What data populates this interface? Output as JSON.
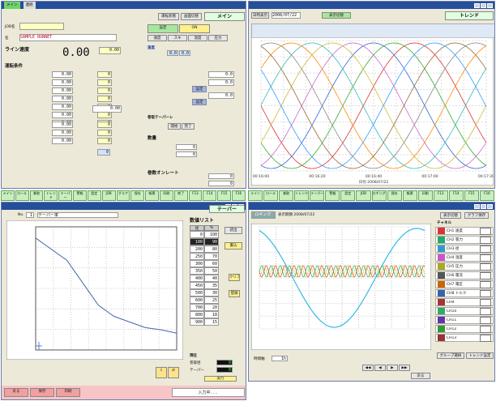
{
  "win_main": {
    "tabs": [
      "メイン",
      "連続"
    ],
    "header_buttons": [
      "運転状態",
      "画面切替"
    ],
    "header_title": "メイン",
    "job_label": "JOB名",
    "sample_label": "SAMPLE RUNNET",
    "main_section": "ライン速度",
    "big_value": "0.00",
    "top_value": "0.00",
    "run_label": "運転条件",
    "run_rows": [
      {
        "v1": "0.00",
        "v2": "0"
      },
      {
        "v1": "0.00",
        "v2": "0"
      },
      {
        "v1": "0.00",
        "v2": "0"
      },
      {
        "v1": "0.00",
        "v2": "0"
      },
      {
        "v1": "0.00",
        "v2": "0"
      },
      {
        "v1": "0.00",
        "v2": "0"
      },
      {
        "v1": "0.00",
        "v2": "0"
      }
    ],
    "mid_value": "0.00",
    "lower_rows": [
      {
        "v1": "0.00",
        "v2": "0"
      },
      {
        "v1": "0.00",
        "v2": "0"
      },
      {
        "v1": "0.00",
        "v2": "0"
      }
    ],
    "bottom_small": "0",
    "right_tabs": [
      "設定",
      "ON",
      "速度",
      "スキ",
      "温度",
      "圧力"
    ],
    "detail_label": "速度",
    "detail_val1": "0.0",
    "detail_val2": "0.0",
    "set_values": [
      "0.0",
      "0.0",
      "0.0"
    ],
    "buttons_blue": [
      "設定",
      "設定"
    ],
    "taper_label": "巻取テーパーレ",
    "taper_buttons": [
      "開始",
      "完了"
    ],
    "count_label": "数量",
    "count_vals": [
      "0",
      "0"
    ],
    "plate_label": "巻数オンレート",
    "plate_vals": [
      "0",
      "0"
    ]
  },
  "win_trend": {
    "header_btn": "日時表示",
    "date_field": "2008/07/22",
    "title": "トレンド",
    "green_btn": "表示切替",
    "x_labels": [
      "00:16:00",
      "00:16:20",
      "00:16:40",
      "00:17:00",
      "00:17:20"
    ],
    "x_caption": "日付:2008/07/22"
  },
  "fkeys_top": [
    "メイン",
    "ロール",
    "巻取",
    "トレンド",
    "テーパー",
    "警報",
    "設定",
    "JOB",
    "グラフ",
    "保存",
    "帳票",
    "印刷",
    "終了",
    "F13",
    "F14",
    "F15",
    "F16"
  ],
  "fkeys_right": [
    "メイン",
    "ロール",
    "巻取",
    "トレンド",
    "テーパー",
    "警報",
    "設定",
    "JOB",
    "ロギング",
    "保存",
    "帳票",
    "印刷",
    "F13",
    "F14",
    "F15",
    "F16"
  ],
  "win_taper": {
    "title": "テーパー",
    "no_label": "No.",
    "no_val": "1",
    "curve_label": "テーパー率",
    "list_title": "数値リスト",
    "list_header": [
      "径",
      "%"
    ],
    "rows": [
      [
        "0",
        "100"
      ],
      [
        "100",
        "90"
      ],
      [
        "200",
        "80"
      ],
      [
        "250",
        "70"
      ],
      [
        "300",
        "60"
      ],
      [
        "350",
        "50"
      ],
      [
        "400",
        "40"
      ],
      [
        "450",
        "35"
      ],
      [
        "500",
        "30"
      ],
      [
        "600",
        "25"
      ],
      [
        "700",
        "20"
      ],
      [
        "800",
        "18"
      ],
      [
        "900",
        "15"
      ]
    ],
    "side_buttons": [
      "読出",
      "書込",
      "クリア",
      "登録"
    ],
    "status_label": "現在",
    "status_vals": [
      "0",
      "0"
    ],
    "status_rows": [
      "巻取径",
      "テーパー"
    ],
    "yellow_btn": "実行",
    "bottom_bar": [
      "戻る",
      "保存",
      "印刷",
      "入力中..."
    ]
  },
  "win_data": {
    "title_field": "ロギング",
    "header_text": "表示期間 2008/07/22",
    "btns": [
      "表示切替",
      "グラフ保存"
    ],
    "time_label": "時間軸",
    "time_val": "1h",
    "scroll_btns": [
      "◀◀",
      "◀",
      "▶",
      "▶▶"
    ],
    "bottom_btns": [
      "グループ選択",
      "トレンド設定",
      "戻る"
    ],
    "list_title": "チャネル",
    "channels": [
      {
        "name": "CH1 速度",
        "color": "#d33"
      },
      {
        "name": "CH2 張力",
        "color": "#2a6"
      },
      {
        "name": "CH3 径",
        "color": "#39c"
      },
      {
        "name": "CH4 温度",
        "color": "#c5c"
      },
      {
        "name": "CH5 圧力",
        "color": "#aa2"
      },
      {
        "name": "CH6 電流",
        "color": "#555"
      },
      {
        "name": "CH7 電圧",
        "color": "#c60"
      },
      {
        "name": "CH8 トルク",
        "color": "#36a"
      },
      {
        "name": "CH9",
        "color": "#a33"
      },
      {
        "name": "CH10",
        "color": "#3a6"
      },
      {
        "name": "CH11",
        "color": "#63a"
      },
      {
        "name": "CH12",
        "color": "#393"
      },
      {
        "name": "CH13",
        "color": "#933"
      }
    ]
  }
}
